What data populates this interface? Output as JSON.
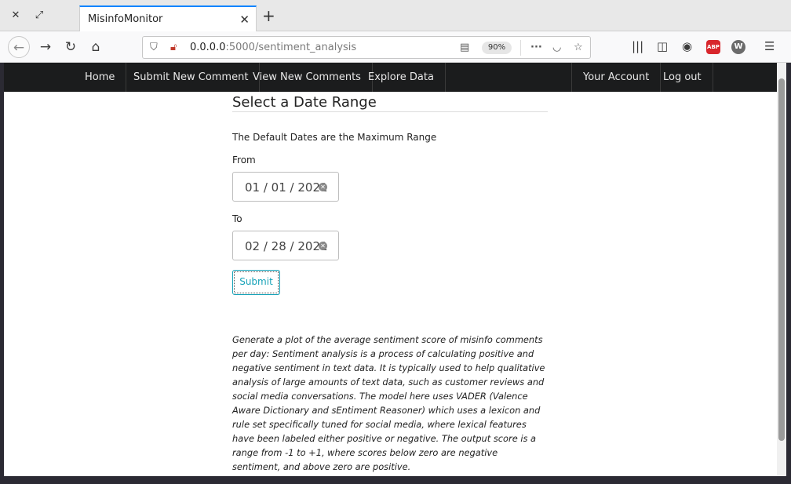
{
  "browser": {
    "tab_title": "MisinfoMonitor",
    "url_host": "0.0.0.0",
    "url_path": ":5000/sentiment_analysis",
    "zoom": "90%",
    "abp_label": "ABP",
    "w_label": "W"
  },
  "nav": {
    "home": "Home",
    "submit_comment": "Submit New Comment",
    "view_comments": "View New Comments",
    "explore_data": "Explore Data",
    "your_account": "Your Account",
    "log_out": "Log out"
  },
  "form": {
    "heading": "Select a Date Range",
    "default_note": "The Default Dates are the Maximum Range",
    "from_label": "From",
    "from_value": "01 / 01 / 2021",
    "to_label": "To",
    "to_value": "02 / 28 / 2021",
    "submit_label": "Submit"
  },
  "description": "Generate a plot of the average sentiment score of misinfo comments per day: Sentiment analysis is a process of calculating positive and negative sentiment in text data. It is typically used to help qualitative analysis of large amounts of text data, such as customer reviews and social media conversations. The model here uses VADER (Valence Aware Dictionary and sEntiment Reasoner) which uses a lexicon and rule set specifically tuned for social media, where lexical features have been labeled either positive or negative. The output score is a range from -1 to +1, where scores below zero are negative sentiment, and above zero are positive."
}
